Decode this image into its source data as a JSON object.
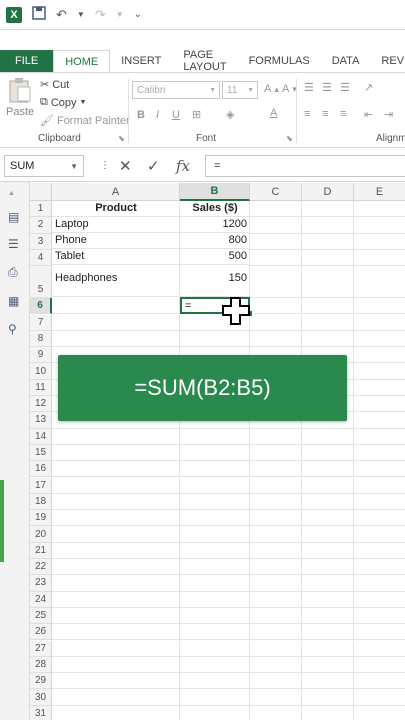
{
  "colors": {
    "accent": "#217346",
    "banner": "#2a8a4e"
  },
  "qat": {
    "icons": [
      "excel-logo-icon",
      "save-icon",
      "undo-icon",
      "redo-icon",
      "customize-icon"
    ],
    "logo_text": "X"
  },
  "tabs": [
    "FILE",
    "HOME",
    "INSERT",
    "PAGE LAYOUT",
    "FORMULAS",
    "DATA",
    "REVIEW"
  ],
  "ribbon": {
    "paste": "Paste",
    "cut": "Cut",
    "copy": "Copy",
    "format_painter": "Format Painter",
    "clipboard_group": "Clipboard",
    "font_name": "Calibri",
    "font_size": "11",
    "font_group": "Font",
    "alignment_group": "Alignm"
  },
  "formula_bar": {
    "name_box": "SUM",
    "cancel": "✕",
    "enter": "✓",
    "fx": "fx",
    "content": "="
  },
  "columns": [
    "A",
    "B",
    "C",
    "D",
    "E"
  ],
  "selected_column": "B",
  "selected_row": "6",
  "rows": [
    "1",
    "2",
    "3",
    "4",
    "5",
    "6",
    "7",
    "8",
    "9",
    "10",
    "11",
    "12",
    "13",
    "14",
    "15",
    "16",
    "17",
    "18",
    "19",
    "20",
    "21",
    "22",
    "23",
    "24",
    "25",
    "26",
    "27",
    "28",
    "29",
    "30",
    "31"
  ],
  "table": {
    "header": {
      "product": "Product",
      "sales": "Sales ($)"
    },
    "rows": [
      {
        "product": "Laptop",
        "sales": "1200"
      },
      {
        "product": "Phone",
        "sales": "800"
      },
      {
        "product": "Tablet",
        "sales": "500"
      },
      {
        "product": "Headphones",
        "sales": "150"
      }
    ],
    "active_cell_value": "="
  },
  "banner_text": "=SUM(B2:B5)"
}
